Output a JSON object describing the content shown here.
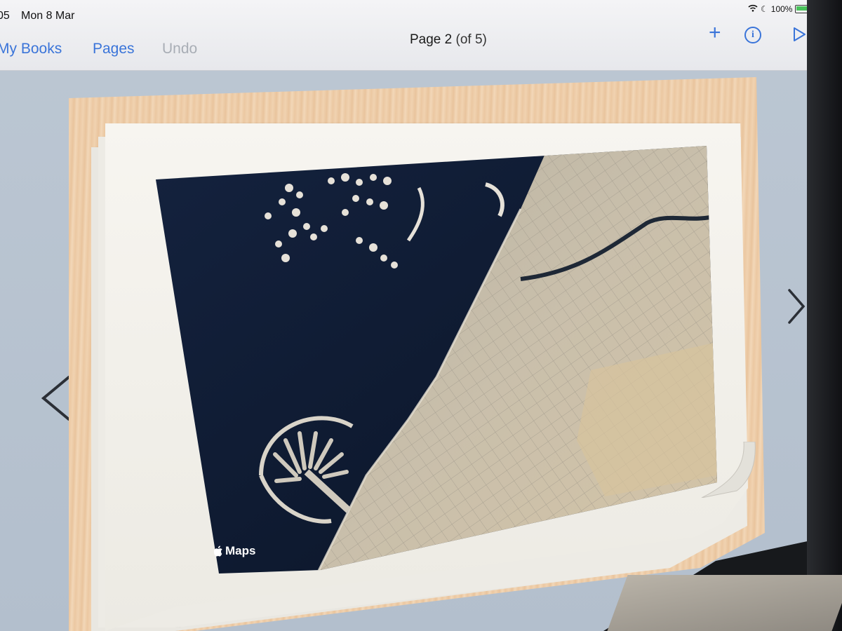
{
  "status": {
    "time_fragment": "05",
    "date": "Mon 8 Mar",
    "battery": "100%"
  },
  "toolbar": {
    "my_books": "My Books",
    "pages": "Pages",
    "undo": "Undo",
    "page_title": "Page 2",
    "page_count": "(of 5)",
    "plus_symbol": "+",
    "info_symbol": "i"
  },
  "map": {
    "attribution": "Maps",
    "icons": {
      "logo": "apple-logo-icon"
    }
  },
  "colors": {
    "accent": "#3a74d9",
    "disabled": "#a8adb5",
    "sea": "#0e1a30",
    "land": "#c8bfae"
  }
}
